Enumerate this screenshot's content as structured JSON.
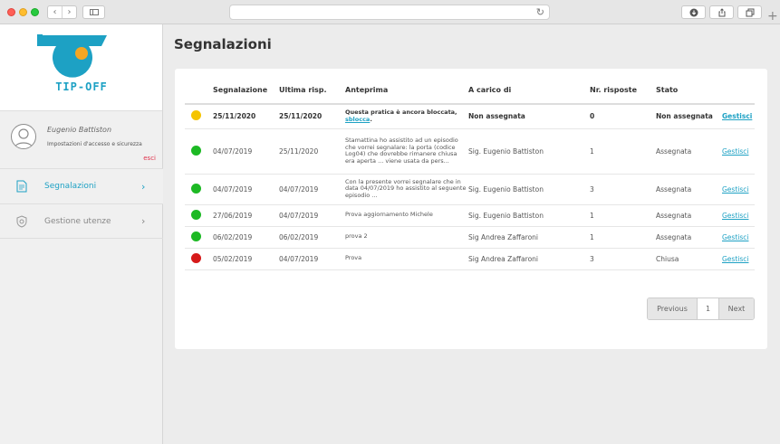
{
  "app": {
    "logo_text": "TIP-OFF",
    "brand_color": "#1da1c4",
    "accent_color": "#f5a623"
  },
  "sidebar": {
    "user": {
      "name": "Eugenio Battiston",
      "settings_link": "Impostazioni d'accesso e sicurezza",
      "logout": "esci"
    },
    "items": [
      {
        "label": "Segnalazioni",
        "icon": "document-icon",
        "active": true,
        "color": "#1da1c4"
      },
      {
        "label": "Gestione utenze",
        "icon": "shield-icon",
        "active": false,
        "color": "#888888"
      }
    ]
  },
  "main": {
    "title": "Segnalazioni",
    "table": {
      "headers": [
        "Segnalazione",
        "Ultima risp.",
        "Anteprima",
        "A carico di",
        "Nr. risposte",
        "Stato"
      ],
      "rows": [
        {
          "status_color": "#f5c400",
          "date": "25/11/2020",
          "last": "25/11/2020",
          "preview": "Questa pratica è ancora bloccata,",
          "preview_link": "sblocca",
          "preview_after": ".",
          "assignee": "Non assegnata",
          "replies": "0",
          "state": "Non assegnata",
          "action": "Gestisci",
          "bold": true
        },
        {
          "status_color": "#1db924",
          "date": "04/07/2019",
          "last": "25/11/2020",
          "preview": "Stamattina ho assistito ad un episodio che vorrei segnalare: la porta (codice Log04) che dovrebbe rimanere chiusa era aperta ... viene usata da pers...",
          "assignee": "Sig. Eugenio Battiston",
          "replies": "1",
          "state": "Assegnata",
          "action": "Gestisci"
        },
        {
          "status_color": "#1db924",
          "date": "04/07/2019",
          "last": "04/07/2019",
          "preview": "Con la presente vorrei segnalare che in data 04/07/2019 ho assistito al seguente episodio ...",
          "assignee": "Sig. Eugenio Battiston",
          "replies": "3",
          "state": "Assegnata",
          "action": "Gestisci"
        },
        {
          "status_color": "#1db924",
          "date": "27/06/2019",
          "last": "04/07/2019",
          "preview": "Prova aggiornamento Michele",
          "assignee": "Sig. Eugenio Battiston",
          "replies": "1",
          "state": "Assegnata",
          "action": "Gestisci"
        },
        {
          "status_color": "#1db924",
          "date": "06/02/2019",
          "last": "06/02/2019",
          "preview": "prova 2",
          "assignee": "Sig Andrea Zaffaroni",
          "replies": "1",
          "state": "Assegnata",
          "action": "Gestisci"
        },
        {
          "status_color": "#d61a1a",
          "date": "05/02/2019",
          "last": "04/07/2019",
          "preview": "Prova",
          "assignee": "Sig Andrea Zaffaroni",
          "replies": "3",
          "state": "Chiusa",
          "action": "Gestisci"
        }
      ]
    },
    "pagination": {
      "previous": "Previous",
      "current": "1",
      "next": "Next"
    }
  }
}
